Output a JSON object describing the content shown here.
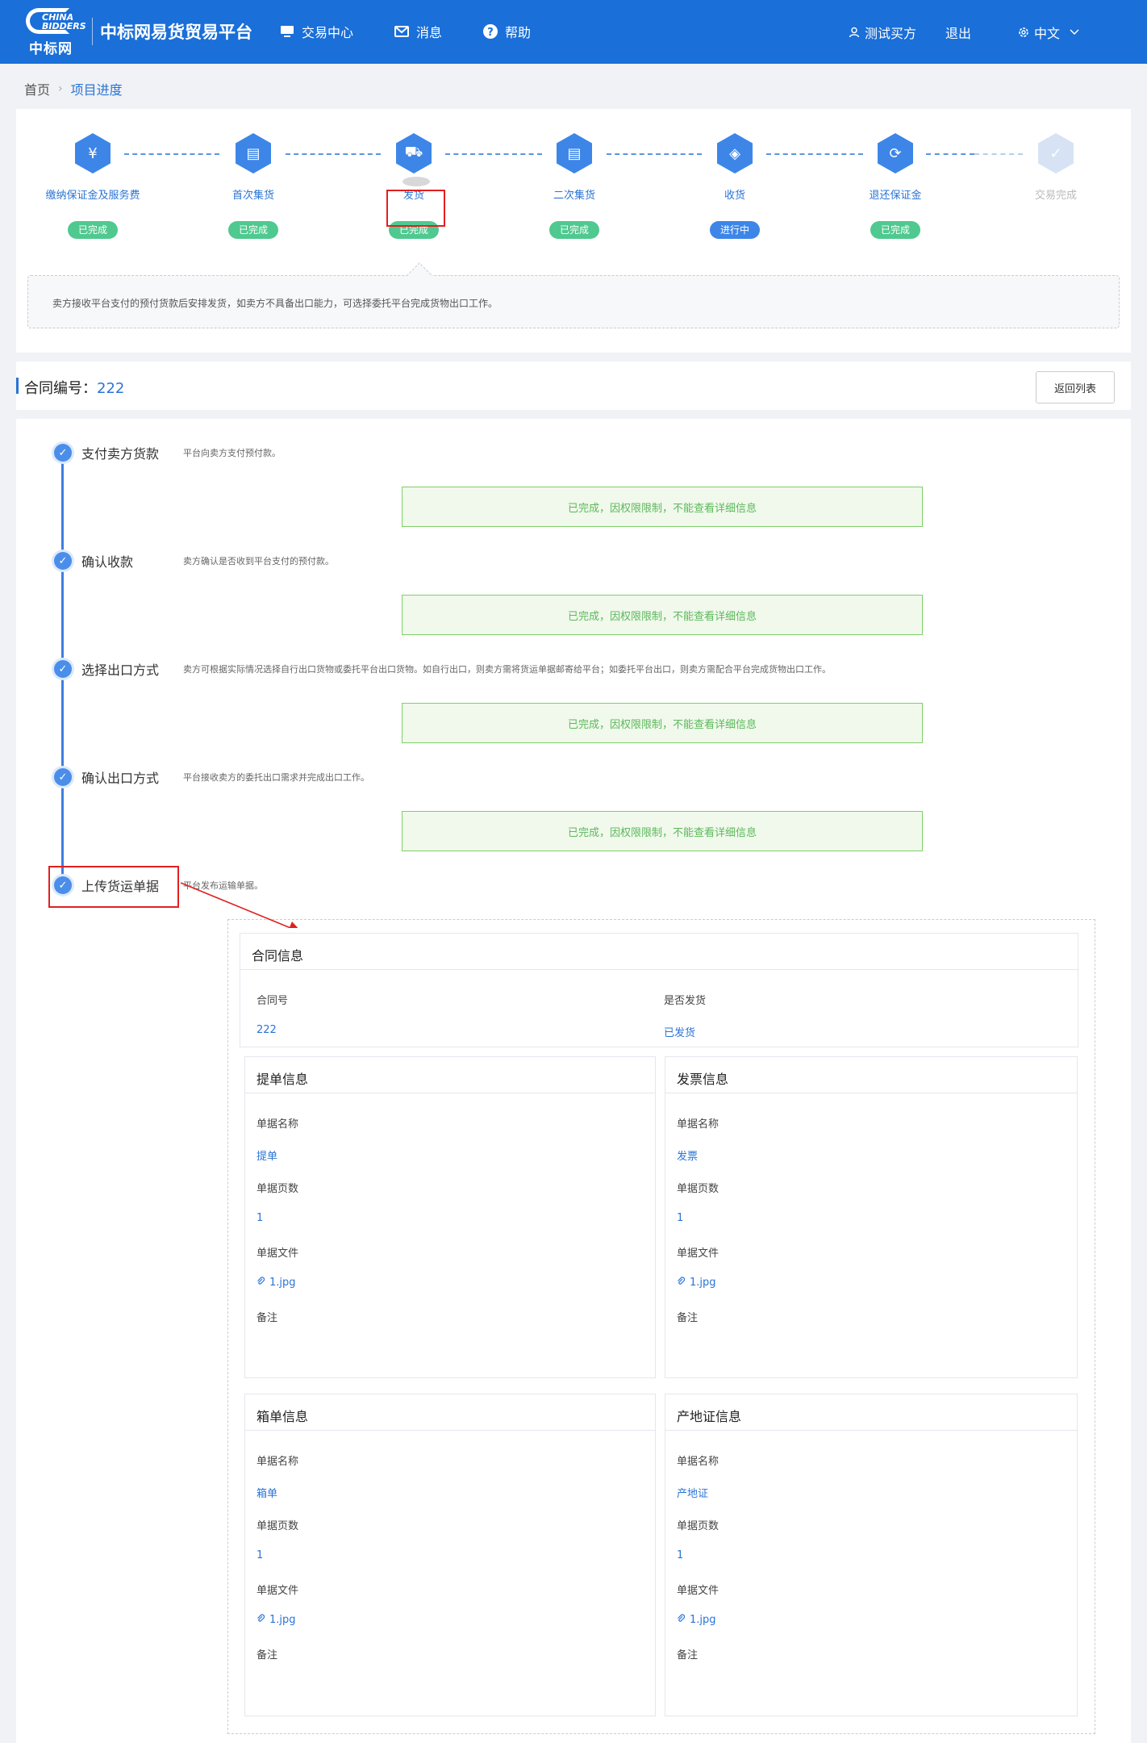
{
  "header": {
    "logo_sub": "CHINA BIDDERS",
    "logo_name": "中标网",
    "title": "中标网易货贸易平台",
    "nav": [
      {
        "label": "交易中心",
        "icon": "monitor-icon"
      },
      {
        "label": "消息",
        "icon": "mail-icon"
      },
      {
        "label": "帮助",
        "icon": "help-icon"
      }
    ],
    "user": "测试买方",
    "logout": "退出",
    "language": "中文"
  },
  "breadcrumb": {
    "home": "首页",
    "current": "项目进度"
  },
  "steps": [
    {
      "label": "缴纳保证金及服务费",
      "status": "已完成",
      "icon": "deposit-icon"
    },
    {
      "label": "首次集货",
      "status": "已完成",
      "icon": "wallet-icon"
    },
    {
      "label": "发货",
      "status": "已完成",
      "icon": "truck-icon"
    },
    {
      "label": "二次集货",
      "status": "已完成",
      "icon": "wallet-icon"
    },
    {
      "label": "收货",
      "status": "进行中",
      "icon": "package-icon"
    },
    {
      "label": "退还保证金",
      "status": "已完成",
      "icon": "refund-icon"
    },
    {
      "label": "交易完成",
      "status": "",
      "icon": "check-icon"
    }
  ],
  "step_tip": "卖方接收平台支付的预付货款后安排发货，如卖方不具备出口能力，可选择委托平台完成货物出口工作。",
  "contract": {
    "label": "合同编号：",
    "number": "222",
    "back_button": "返回列表"
  },
  "timeline": [
    {
      "title": "支付卖方货款",
      "desc": "平台向卖方支付预付款。",
      "status": "已完成，因权限限制，不能查看详细信息"
    },
    {
      "title": "确认收款",
      "desc": "卖方确认是否收到平台支付的预付款。",
      "status": "已完成，因权限限制，不能查看详细信息"
    },
    {
      "title": "选择出口方式",
      "desc": "卖方可根据实际情况选择自行出口货物或委托平台出口货物。如自行出口，则卖方需将货运单据邮寄给平台；如委托平台出口，则卖方需配合平台完成货物出口工作。",
      "status": "已完成，因权限限制，不能查看详细信息"
    },
    {
      "title": "确认出口方式",
      "desc": "平台接收卖方的委托出口需求并完成出口工作。",
      "status": "已完成，因权限限制，不能查看详细信息"
    },
    {
      "title": "上传货运单据",
      "desc": "平台发布运输单据。",
      "status": ""
    }
  ],
  "contract_info": {
    "title": "合同信息",
    "fields": [
      {
        "label": "合同号",
        "value": "222"
      },
      {
        "label": "是否发货",
        "value": "已发货"
      }
    ]
  },
  "doc_cards": [
    {
      "title": "提单信息",
      "name_label": "单据名称",
      "name": "提单",
      "pages_label": "单据页数",
      "pages": "1",
      "file_label": "单据文件",
      "file": "1.jpg",
      "remark_label": "备注"
    },
    {
      "title": "发票信息",
      "name_label": "单据名称",
      "name": "发票",
      "pages_label": "单据页数",
      "pages": "1",
      "file_label": "单据文件",
      "file": "1.jpg",
      "remark_label": "备注"
    },
    {
      "title": "箱单信息",
      "name_label": "单据名称",
      "name": "箱单",
      "pages_label": "单据页数",
      "pages": "1",
      "file_label": "单据文件",
      "file": "1.jpg",
      "remark_label": "备注"
    },
    {
      "title": "产地证信息",
      "name_label": "单据名称",
      "name": "产地证",
      "pages_label": "单据页数",
      "pages": "1",
      "file_label": "单据文件",
      "file": "1.jpg",
      "remark_label": "备注"
    }
  ],
  "colors": {
    "primary": "#1a6fd8",
    "done": "#4fc98f",
    "doing": "#3d86e8",
    "highlight": "#e02020",
    "success_text": "#5cb85c"
  }
}
